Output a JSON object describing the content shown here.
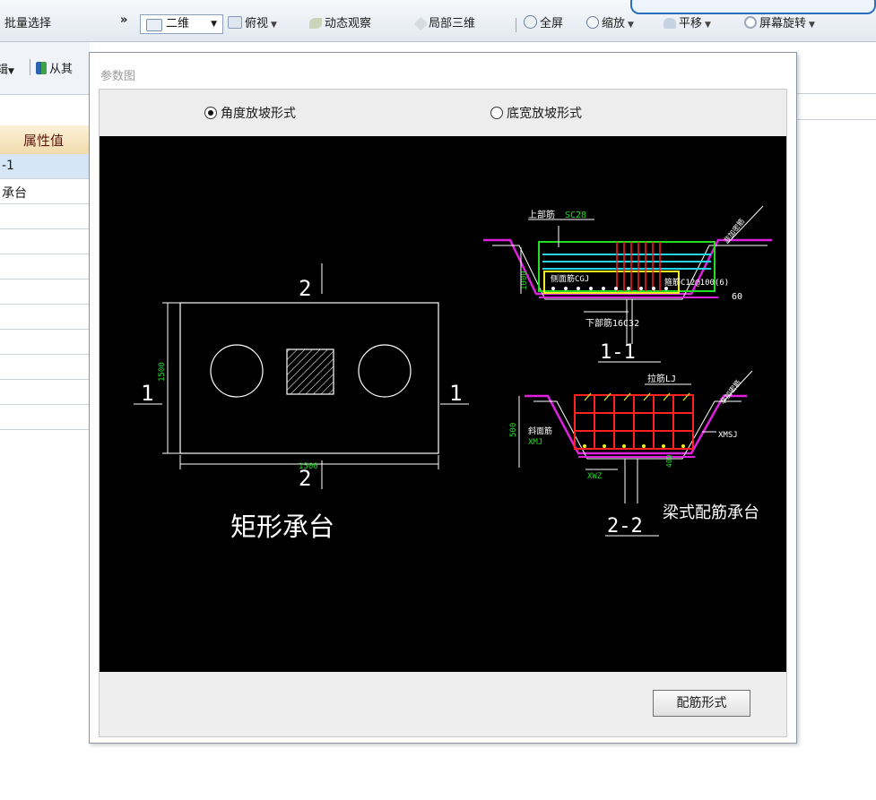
{
  "toolbar": {
    "batch_select": "批量选择",
    "overflow": "»",
    "view_2d": "二维",
    "top_view": "俯视",
    "dynamic_view": "动态观察",
    "local_3d": "局部三维",
    "fullscreen": "全屏",
    "zoom": "缩放",
    "pan": "平移",
    "screen_rotate": "屏幕旋转"
  },
  "toolbar2": {
    "left_fragment": "辑",
    "from_other": "从其"
  },
  "grid": {
    "header": "属性值",
    "rows": [
      "-1",
      "承台",
      "",
      "",
      "",
      "",
      "",
      "",
      "",
      "",
      ""
    ]
  },
  "dialog": {
    "title": "参数图",
    "radio_angle": "角度放坡形式",
    "radio_width": "底宽放坡形式",
    "radio_selected": "angle",
    "ok_button": "配筋形式"
  },
  "drawing": {
    "rect": {
      "section_mark_top": "2",
      "section_mark_bottom": "2",
      "section_mark_left": "1",
      "section_mark_right": "1",
      "dim_height": "1500",
      "dim_width": "1500",
      "caption": "矩形承台"
    },
    "section11": {
      "top_rebar": "上部筋",
      "top_rebar_code": "SC28",
      "side_rebar": "侧面筋CGJ",
      "stirrup": "箍筋C12@100(6)",
      "bottom_rebar": "下部筋16C32",
      "dim_height": "1000",
      "angle": "60",
      "title": "1-1"
    },
    "section22": {
      "pile_rebar": "拉筋LJ",
      "side_rebar": "斜面筋",
      "side_rebar_code": "XMJ",
      "slope_rebar": "XMSJ",
      "bottom_label": "XWZ",
      "dim_height": "500",
      "dim_small": "400",
      "title": "2-2",
      "caption": "梁式配筋承台"
    }
  },
  "colors": {
    "accent": "#2a6fbf",
    "canvas_bg": "#000000",
    "rebar_green": "#22dd22",
    "rebar_red": "#ff2020",
    "slope_magenta": "#e020e0",
    "rebar_cyan": "#20d8e8",
    "rebar_yellow": "#f0f020"
  }
}
